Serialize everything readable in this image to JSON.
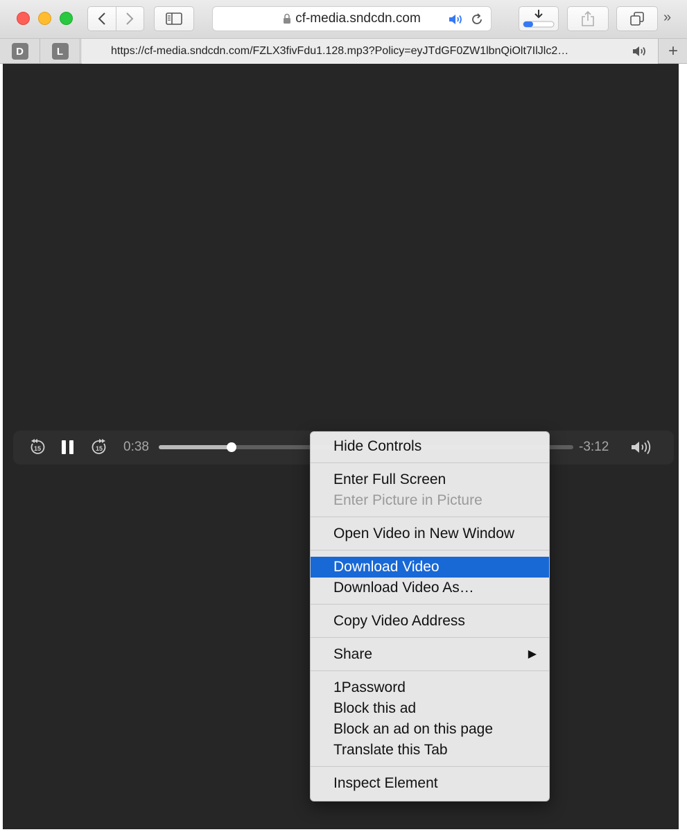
{
  "toolbar": {
    "host": "cf-media.sndcdn.com",
    "overflow": "»"
  },
  "tabs": {
    "pinned": [
      "D",
      "L"
    ],
    "active_title": "https://cf-media.sndcdn.com/FZLX3fivFdu1.128.mp3?Policy=eyJTdGF0ZW1lbnQiOlt7IlJlc2…",
    "new_tab": "+"
  },
  "player": {
    "elapsed": "0:38",
    "remaining": "-3:12",
    "progress": 0.175,
    "skip_seconds": "15"
  },
  "context_menu": {
    "groups": [
      [
        "Hide Controls"
      ],
      [
        "Enter Full Screen",
        "Enter Picture in Picture"
      ],
      [
        "Open Video in New Window"
      ],
      [
        "Download Video",
        "Download Video As…"
      ],
      [
        "Copy Video Address"
      ],
      [
        "Share"
      ],
      [
        "1Password",
        "Block this ad",
        "Block an ad on this page",
        "Translate this Tab"
      ],
      [
        "Inspect Element"
      ]
    ],
    "disabled": [
      "Enter Picture in Picture"
    ],
    "highlighted": "Download Video",
    "submenu_arrow": "▶"
  },
  "colors": {
    "highlight": "#1868d6",
    "accent_blue": "#3478f6",
    "video_bg": "#262626"
  }
}
